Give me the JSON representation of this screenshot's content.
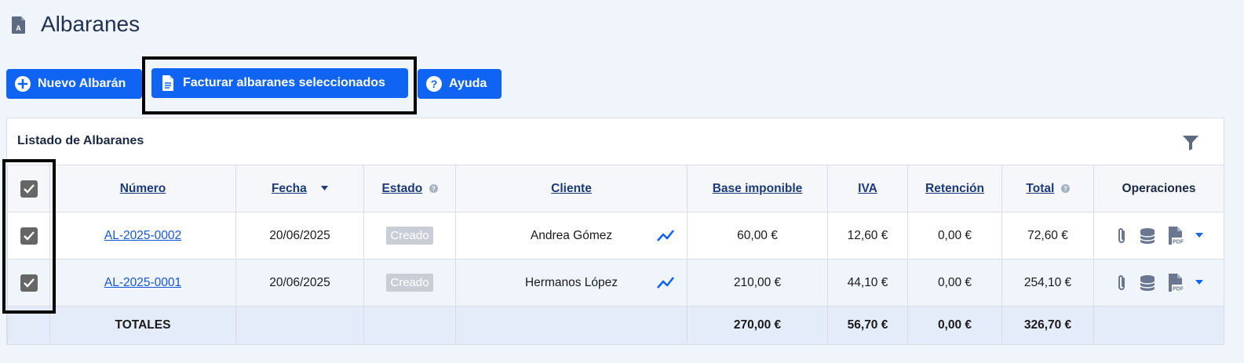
{
  "page": {
    "title": "Albaranes"
  },
  "toolbar": {
    "new_label": "Nuevo Albarán",
    "invoice_label": "Facturar albaranes seleccionados",
    "help_label": "Ayuda"
  },
  "panel": {
    "title": "Listado de Albaranes"
  },
  "table": {
    "headers": {
      "numero": "Número",
      "fecha": "Fecha",
      "estado": "Estado",
      "cliente": "Cliente",
      "base": "Base imponible",
      "iva": "IVA",
      "retencion": "Retención",
      "total": "Total",
      "operaciones": "Operaciones"
    },
    "rows": [
      {
        "numero": "AL-2025-0002",
        "fecha": "20/06/2025",
        "estado": "Creado",
        "cliente": "Andrea Gómez",
        "base": "60,00 €",
        "iva": "12,60 €",
        "retencion": "0,00 €",
        "total": "72,60 €",
        "checked": true
      },
      {
        "numero": "AL-2025-0001",
        "fecha": "20/06/2025",
        "estado": "Creado",
        "cliente": "Hermanos López",
        "base": "210,00 €",
        "iva": "44,10 €",
        "retencion": "0,00 €",
        "total": "254,10 €",
        "checked": true
      }
    ],
    "totals": {
      "label": "TOTALES",
      "base": "270,00 €",
      "iva": "56,70 €",
      "retencion": "0,00 €",
      "total": "326,70 €"
    }
  },
  "colors": {
    "primary": "#1064f4",
    "link": "#1557d6",
    "badge": "#c9ced6",
    "checkbox": "#666666",
    "highlight": "#000000"
  }
}
